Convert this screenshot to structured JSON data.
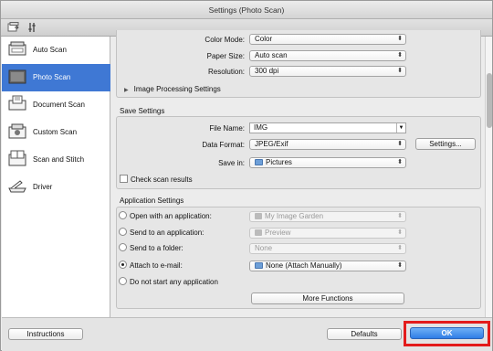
{
  "window": {
    "title": "Settings (Photo Scan)"
  },
  "toolbar": {
    "icons": [
      "scan-from-computer-icon",
      "scanner-settings-icon"
    ]
  },
  "sidebar": {
    "items": [
      {
        "label": "Auto Scan",
        "icon": "auto-scan-icon",
        "selected": false
      },
      {
        "label": "Photo Scan",
        "icon": "photo-scan-icon",
        "selected": true
      },
      {
        "label": "Document Scan",
        "icon": "document-scan-icon",
        "selected": false
      },
      {
        "label": "Custom Scan",
        "icon": "custom-scan-icon",
        "selected": false
      },
      {
        "label": "Scan and Stitch",
        "icon": "scan-and-stitch-icon",
        "selected": false
      },
      {
        "label": "Driver",
        "icon": "driver-icon",
        "selected": false
      }
    ]
  },
  "scan_options": {
    "color_mode": {
      "label": "Color Mode:",
      "value": "Color"
    },
    "paper_size": {
      "label": "Paper Size:",
      "value": "Auto scan"
    },
    "resolution": {
      "label": "Resolution:",
      "value": "300 dpi"
    },
    "image_processing": {
      "label": "Image Processing Settings",
      "expanded": false
    }
  },
  "save_settings": {
    "title": "Save Settings",
    "file_name": {
      "label": "File Name:",
      "value": "IMG"
    },
    "data_format": {
      "label": "Data Format:",
      "value": "JPEG/Exif"
    },
    "settings_button": "Settings...",
    "save_in": {
      "label": "Save in:",
      "value": "Pictures"
    },
    "check_scan_results": {
      "label": "Check scan results",
      "checked": false
    }
  },
  "application_settings": {
    "title": "Application Settings",
    "options": [
      {
        "label": "Open with an application:",
        "value": "My Image Garden",
        "selected": false,
        "enabled": false
      },
      {
        "label": "Send to an application:",
        "value": "Preview",
        "selected": false,
        "enabled": false
      },
      {
        "label": "Send to a folder:",
        "value": "None",
        "selected": false,
        "enabled": false
      },
      {
        "label": "Attach to e-mail:",
        "value": "None (Attach Manually)",
        "selected": true,
        "enabled": true
      },
      {
        "label": "Do not start any application",
        "selected": false
      }
    ],
    "more_functions": "More Functions"
  },
  "footer": {
    "instructions": "Instructions",
    "defaults": "Defaults",
    "ok": "OK"
  },
  "colors": {
    "selection": "#3f78d4",
    "ok_button": "#2f7ee6",
    "highlight_box": "#e31c1c"
  }
}
